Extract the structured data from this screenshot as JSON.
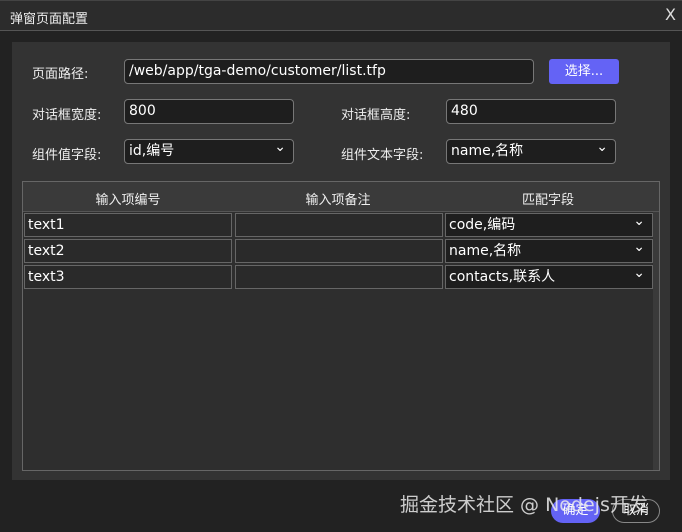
{
  "window": {
    "title": "弹窗页面配置",
    "close": "X"
  },
  "form": {
    "path_label": "页面路径:",
    "path_value": "/web/app/tga-demo/customer/list.tfp",
    "choose_label": "选择...",
    "width_label": "对话框宽度:",
    "width_value": "800",
    "height_label": "对话框高度:",
    "height_value": "480",
    "value_field_label": "组件值字段:",
    "value_field_value": "id,编号",
    "text_field_label": "组件文本字段:",
    "text_field_value": "name,名称"
  },
  "table": {
    "headers": [
      "输入项编号",
      "输入项备注",
      "匹配字段"
    ],
    "rows": [
      {
        "id": "text1",
        "note": "",
        "field": "code,编码"
      },
      {
        "id": "text2",
        "note": "",
        "field": "name,名称"
      },
      {
        "id": "text3",
        "note": "",
        "field": "contacts,联系人"
      }
    ]
  },
  "footer": {
    "ok": "确定",
    "cancel": "取消"
  },
  "watermark": "掘金技术社区 @ Nodejs开发"
}
